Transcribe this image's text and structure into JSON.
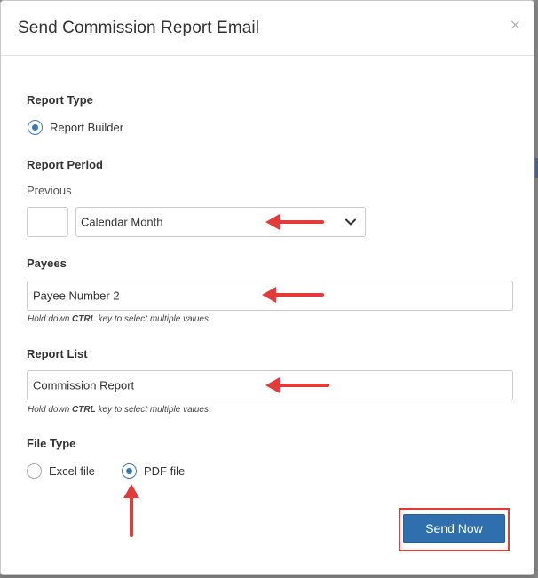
{
  "dialog": {
    "title": "Send Commission Report Email",
    "close_glyph": "×"
  },
  "report_type": {
    "label": "Report Type",
    "options": [
      {
        "label": "Report Builder",
        "checked": true
      }
    ]
  },
  "report_period": {
    "label": "Report Period",
    "previous_label": "Previous",
    "previous_value": "",
    "period_select": {
      "value": "Calendar Month",
      "icon": "chevron-down-icon"
    }
  },
  "payees": {
    "label": "Payees",
    "value": "Payee Number 2",
    "help_prefix": "Hold down ",
    "help_key": "CTRL",
    "help_suffix": " key to select multiple values"
  },
  "report_list": {
    "label": "Report List",
    "value": "Commission Report",
    "help_prefix": "Hold down ",
    "help_key": "CTRL",
    "help_suffix": " key to select multiple values"
  },
  "file_type": {
    "label": "File Type",
    "options": [
      {
        "label": "Excel file",
        "checked": false
      },
      {
        "label": "PDF file",
        "checked": true
      }
    ]
  },
  "actions": {
    "send_label": "Send Now"
  },
  "colors": {
    "primary": "#2f6fae",
    "annotation_red": "#e53a3a",
    "radio_checked": "#3b78b7"
  }
}
